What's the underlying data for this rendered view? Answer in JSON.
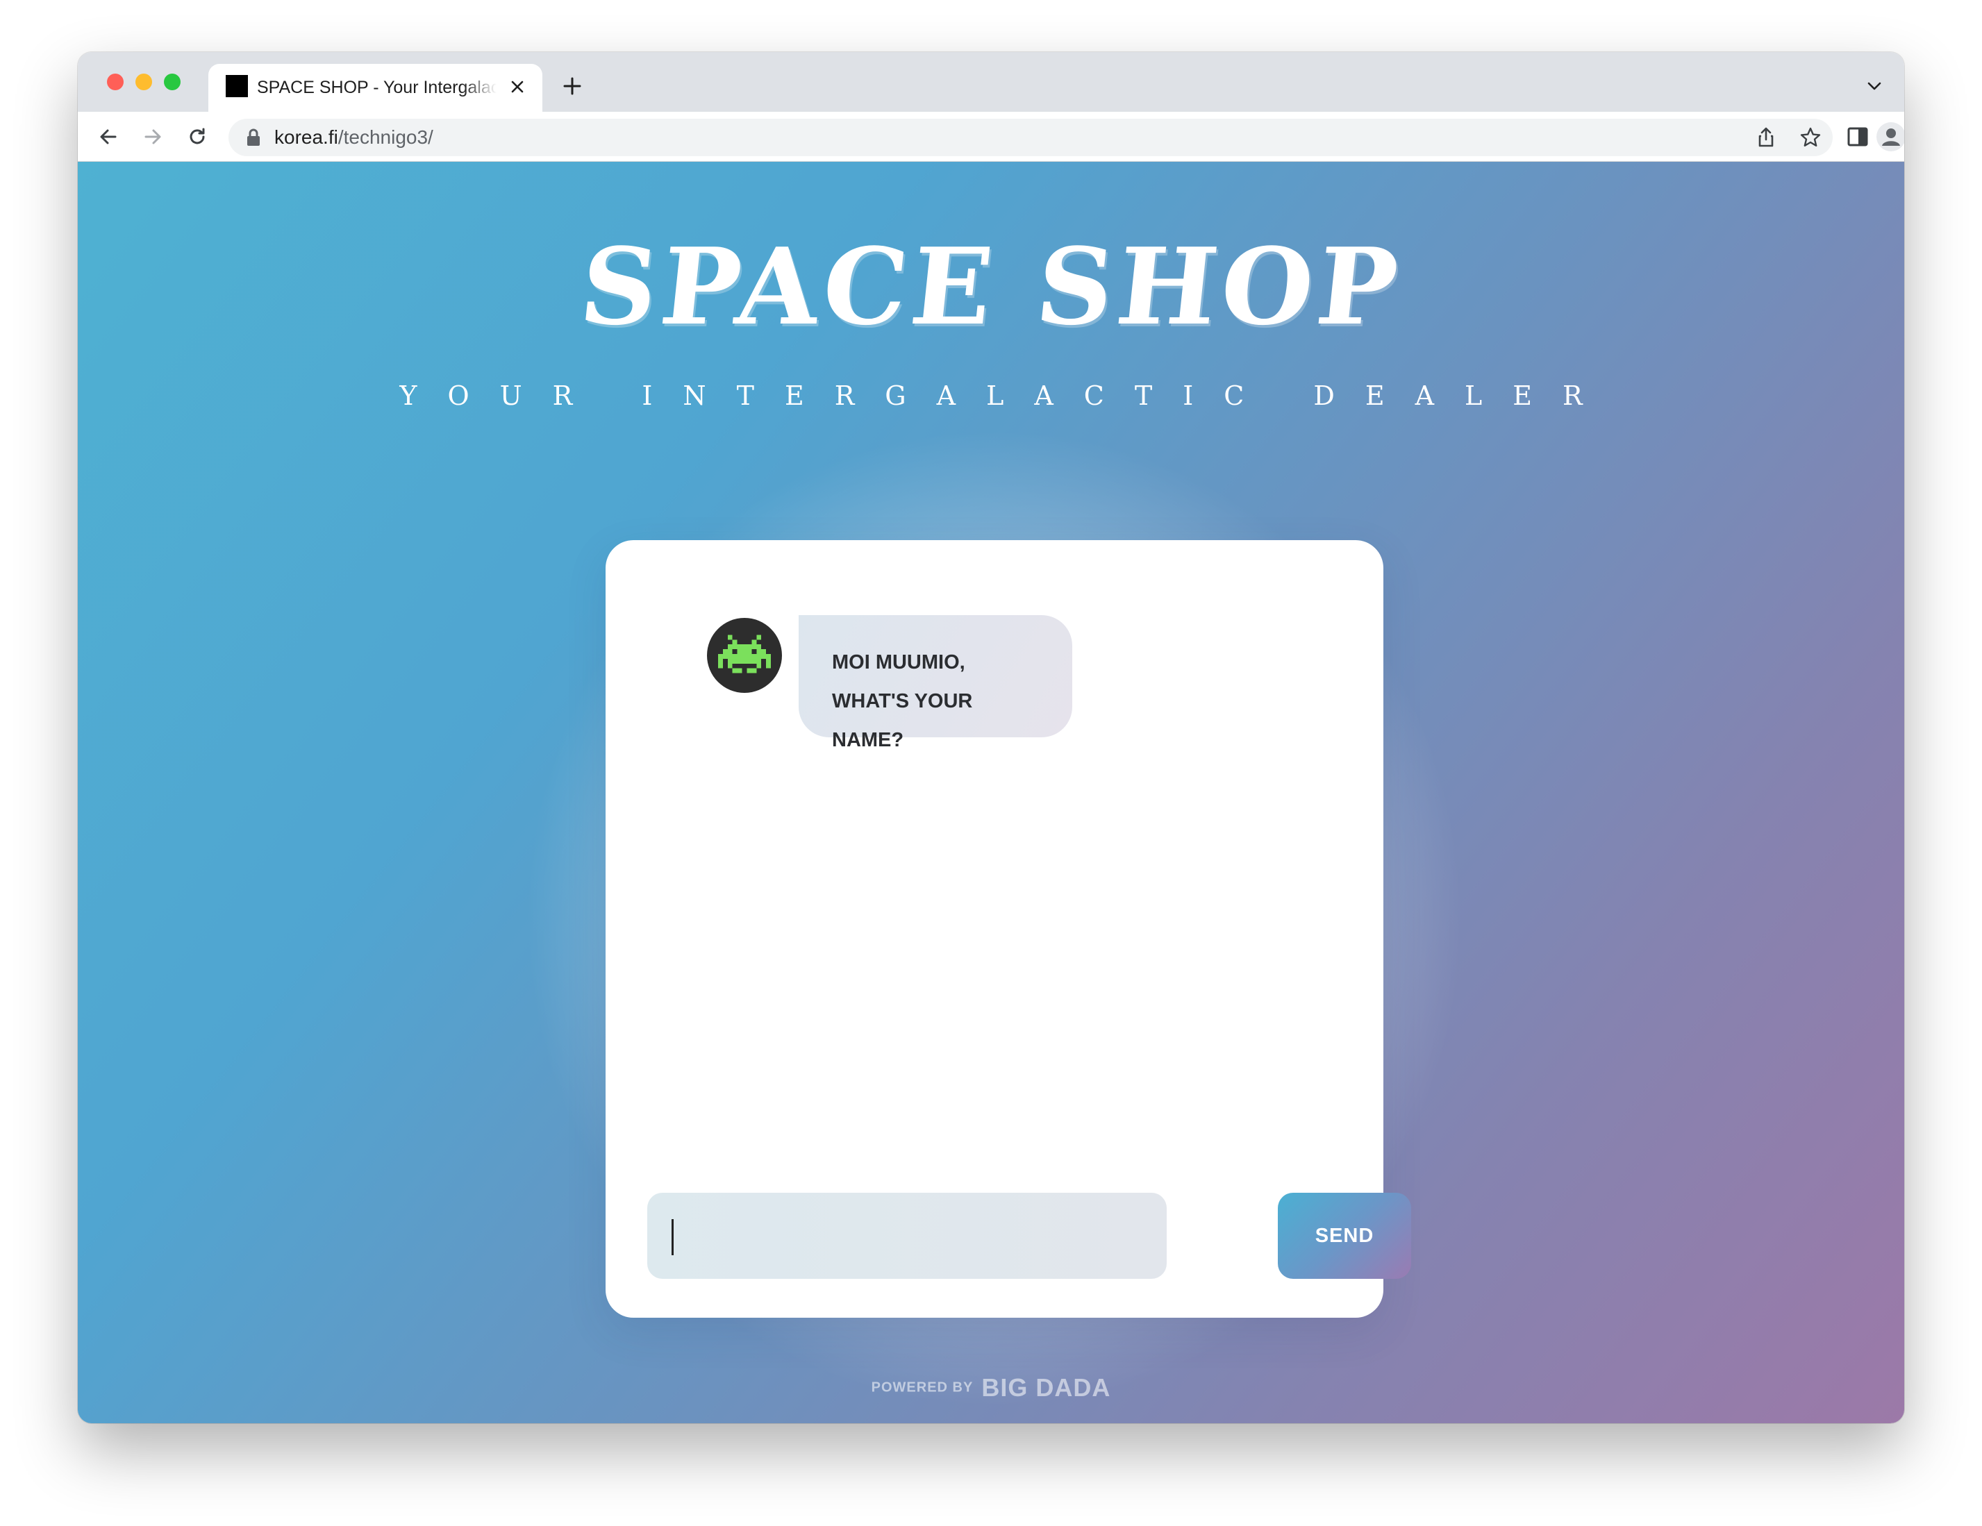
{
  "browser": {
    "tab_title": "SPACE SHOP - Your Intergalactic Dealer",
    "url_domain": "korea.fi",
    "url_path": "/technigo3/"
  },
  "page": {
    "title": "SPACE SHOP",
    "subtitle": "YOUR INTERGALACTIC DEALER"
  },
  "chat": {
    "bot_avatar_icon": "space-invader-icon",
    "bot_avatar_color": "#7be05c",
    "messages": [
      {
        "sender": "bot",
        "text": "MOI MUUMIO, WHAT'S YOUR NAME?"
      }
    ],
    "input_value": "",
    "send_label": "SEND"
  },
  "footer": {
    "powered_label": "POWERED BY",
    "brand": "BIG DADA"
  },
  "colors": {
    "gradient_start": "#4fb1d2",
    "gradient_end": "#9c79a8",
    "card": "#ffffff"
  }
}
